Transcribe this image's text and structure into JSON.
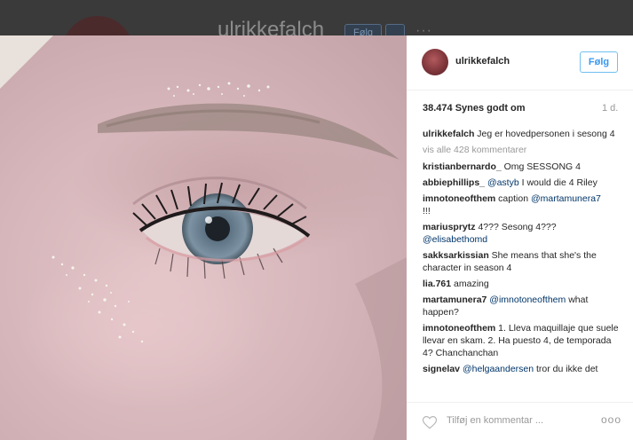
{
  "background": {
    "username": "ulrikkefalch",
    "follow_label": "Følg"
  },
  "post": {
    "username": "ulrikkefalch",
    "follow_label": "Følg",
    "likes": "38.474 Synes godt om",
    "time": "1 d.",
    "caption_user": "ulrikkefalch",
    "caption_text": "Jeg er hovedpersonen i sesong 4",
    "view_all": "vis alle 428 kommentarer",
    "comments": [
      {
        "user": "kristianbernardo_",
        "parts": [
          "Omg SESSONG 4"
        ]
      },
      {
        "user": "abbiephillips_",
        "mention": "@astyb",
        "text": "I would die 4 Riley"
      },
      {
        "user": "imnotoneofthem",
        "text": "caption",
        "mention": "@martamunera7",
        "text2": "!!!"
      },
      {
        "user": "mariusprytz",
        "text": "4??? Sesong 4???",
        "mention": "@elisabethomd"
      },
      {
        "user": "sakksarkissian",
        "text": "She means that she's the character in season 4"
      },
      {
        "user": "lia.761",
        "text": "amazing"
      },
      {
        "user": "martamunera7",
        "mention": "@imnotoneofthem",
        "text": "what happen?"
      },
      {
        "user": "imnotoneofthem",
        "text": "1. Lleva maquillaje que suele llevar en skam. 2. Ha puesto 4, de temporada 4? Chanchanchan"
      },
      {
        "user": "signelav",
        "mention": "@helgaandersen",
        "text": "tror du ikke det"
      }
    ],
    "comment_placeholder": "Tilføj en kommentar ...",
    "more": "ooo"
  },
  "icons": {
    "heart": "heart-outline-icon",
    "more": "more-options-icon"
  },
  "colors": {
    "link": "#003569",
    "follow": "#3897f0",
    "muted": "#999999"
  }
}
